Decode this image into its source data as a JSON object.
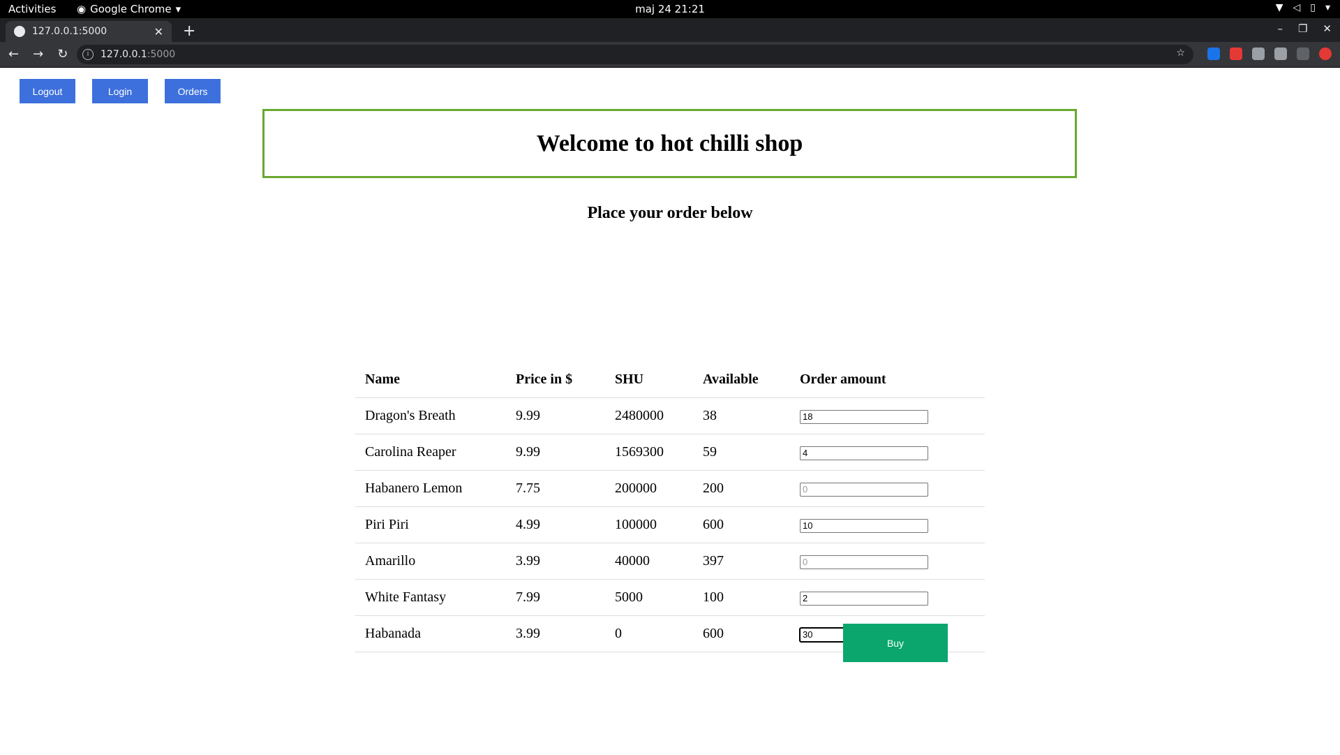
{
  "system_bar": {
    "activities": "Activities",
    "app_name": "Google Chrome",
    "clock": "maj 24  21:21"
  },
  "browser": {
    "tab_title": "127.0.0.1:5000",
    "url_host": "127.0.0.1",
    "url_port": ":5000"
  },
  "nav": {
    "logout": "Logout",
    "login": "Login",
    "orders": "Orders"
  },
  "header": {
    "title": "Welcome to hot chilli shop",
    "subtitle": "Place your order below"
  },
  "table": {
    "columns": [
      "Name",
      "Price in $",
      "SHU",
      "Available",
      "Order amount"
    ],
    "placeholder": "0",
    "rows": [
      {
        "name": "Dragon's Breath",
        "price": "9.99",
        "shu": "2480000",
        "available": "38",
        "amount": "18"
      },
      {
        "name": "Carolina Reaper",
        "price": "9.99",
        "shu": "1569300",
        "available": "59",
        "amount": "4"
      },
      {
        "name": "Habanero Lemon",
        "price": "7.75",
        "shu": "200000",
        "available": "200",
        "amount": ""
      },
      {
        "name": "Piri Piri",
        "price": "4.99",
        "shu": "100000",
        "available": "600",
        "amount": "10"
      },
      {
        "name": "Amarillo",
        "price": "3.99",
        "shu": "40000",
        "available": "397",
        "amount": ""
      },
      {
        "name": "White Fantasy",
        "price": "7.99",
        "shu": "5000",
        "available": "100",
        "amount": "2"
      },
      {
        "name": "Habanada",
        "price": "3.99",
        "shu": "0",
        "available": "600",
        "amount": "30"
      }
    ]
  },
  "buy_label": "Buy",
  "colors": {
    "nav_button": "#3d70dc",
    "buy_button": "#0aa66e",
    "welcome_border": "#6aa831"
  }
}
